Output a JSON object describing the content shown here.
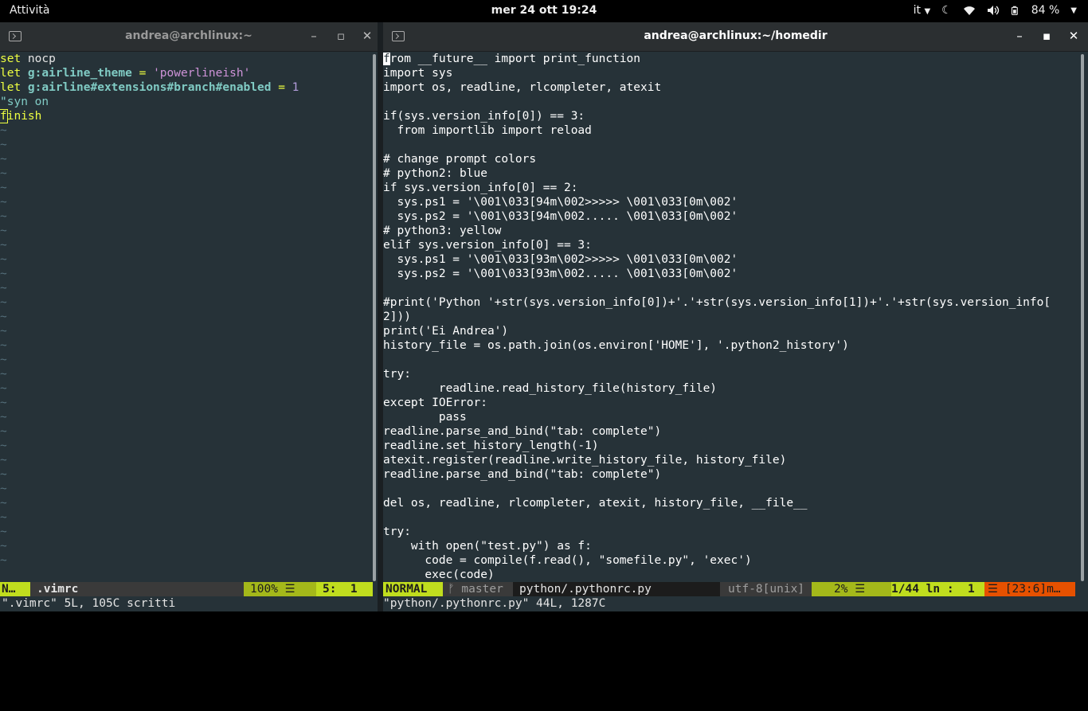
{
  "topbar": {
    "activities": "Attività",
    "clock": "mer 24 ott  19:24",
    "lang": "it",
    "battery": "84 %"
  },
  "left": {
    "title": "andrea@archlinux:~",
    "lines": [
      [
        [
          "kw",
          "set "
        ],
        [
          "plain",
          "nocp"
        ]
      ],
      [
        [
          "kw",
          "let "
        ],
        [
          "var",
          "g:airline_theme"
        ],
        [
          "op",
          " = "
        ],
        [
          "str",
          "'powerlineish'"
        ]
      ],
      [
        [
          "kw",
          "let "
        ],
        [
          "var",
          "g:airline#extensions#branch#enabled"
        ],
        [
          "op",
          " = "
        ],
        [
          "num",
          "1"
        ]
      ],
      [
        [
          "cmt",
          "\"syn on"
        ]
      ],
      [
        [
          "kw",
          "finish"
        ]
      ]
    ],
    "status": {
      "mode": "N…",
      "file": ".vimrc",
      "percent": "100% ☰",
      "pos": "5:  1"
    },
    "cmdline": "\".vimrc\" 5L, 105C scritti"
  },
  "right": {
    "title": "andrea@archlinux:~/homedir",
    "lines": [
      "from __future__ import print_function",
      "import sys",
      "import os, readline, rlcompleter, atexit",
      "",
      "if(sys.version_info[0]) == 3:",
      "  from importlib import reload",
      "",
      "# change prompt colors",
      "# python2: blue",
      "if sys.version_info[0] == 2:",
      "  sys.ps1 = '\\001\\033[94m\\002>>>>> \\001\\033[0m\\002'",
      "  sys.ps2 = '\\001\\033[94m\\002..... \\001\\033[0m\\002'",
      "# python3: yellow",
      "elif sys.version_info[0] == 3:",
      "  sys.ps1 = '\\001\\033[93m\\002>>>>> \\001\\033[0m\\002'",
      "  sys.ps2 = '\\001\\033[93m\\002..... \\001\\033[0m\\002'",
      "",
      "#print('Python '+str(sys.version_info[0])+'.'+str(sys.version_info[1])+'.'+str(sys.version_info[",
      "2]))",
      "print('Ei Andrea')",
      "history_file = os.path.join(os.environ['HOME'], '.python2_history')",
      "",
      "try:",
      "        readline.read_history_file(history_file)",
      "except IOError:",
      "        pass",
      "readline.parse_and_bind(\"tab: complete\")",
      "readline.set_history_length(-1)",
      "atexit.register(readline.write_history_file, history_file)",
      "readline.parse_and_bind(\"tab: complete\")",
      "",
      "del os, readline, rlcompleter, atexit, history_file, __file__",
      "",
      "try:",
      "    with open(\"test.py\") as f:",
      "      code = compile(f.read(), \"somefile.py\", 'exec')",
      "      exec(code)"
    ],
    "status": {
      "mode": "NORMAL",
      "branch": "ᚠ master",
      "file": "python/.pythonrc.py",
      "encoding": "utf-8[unix]",
      "percent": "2% ☰",
      "pos": "1/44 ln :  1",
      "warning": "☰ [23:6]m…"
    },
    "cmdline": "\"python/.pythonrc.py\" 44L, 1287C"
  },
  "colors": {
    "terminal_bg": "#263238",
    "airline_green": "#c0dd1e",
    "airline_dark": "#1c1c1c",
    "airline_mid": "#3a3a3a",
    "warning_orange": "#e65100"
  }
}
